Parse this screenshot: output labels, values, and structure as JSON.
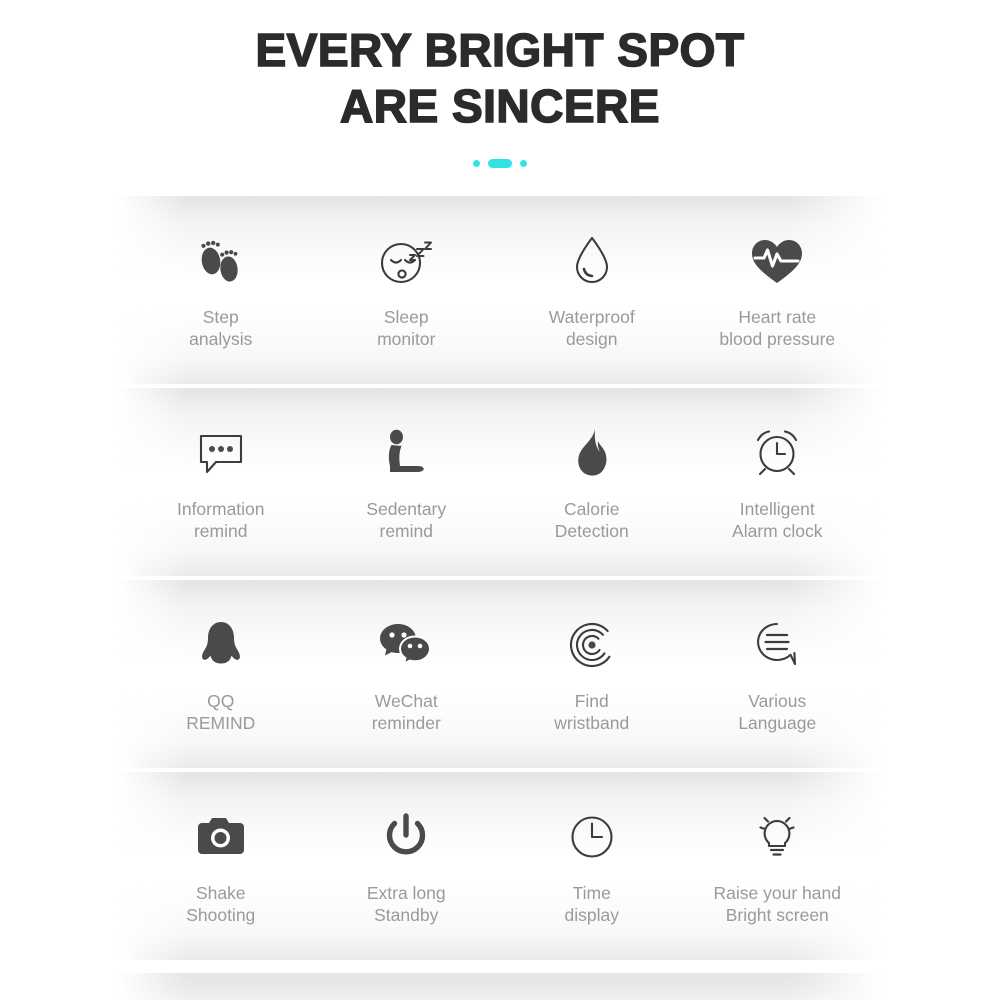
{
  "header": {
    "line1": "EVERY BRIGHT SPOT",
    "line2": "ARE SINCERE",
    "accent_color": "#33e2e2",
    "decoration": [
      "dot",
      "pill",
      "dot"
    ]
  },
  "colors": {
    "heading": "#2b2b2b",
    "label": "#9a9a9c",
    "icon": "#4a4a4a",
    "band": "#e2e3e5",
    "page_background": "#ffffff"
  },
  "rows": [
    {
      "cells": [
        {
          "icon": "footprints-icon",
          "label": "Step\nanalysis"
        },
        {
          "icon": "sleeping-face-icon",
          "label": "Sleep\nmonitor"
        },
        {
          "icon": "water-drop-icon",
          "label": "Waterproof\ndesign"
        },
        {
          "icon": "heart-pulse-icon",
          "label": "Heart rate\nblood pressure"
        }
      ]
    },
    {
      "cells": [
        {
          "icon": "speech-bubble-dots-icon",
          "label": "Information\nremind"
        },
        {
          "icon": "sitting-person-icon",
          "label": "Sedentary\nremind"
        },
        {
          "icon": "flame-icon",
          "label": "Calorie\nDetection"
        },
        {
          "icon": "alarm-clock-icon",
          "label": "Intelligent\nAlarm clock"
        }
      ]
    },
    {
      "cells": [
        {
          "icon": "qq-penguin-icon",
          "label": "QQ\nREMIND"
        },
        {
          "icon": "wechat-bubbles-icon",
          "label": "WeChat\nreminder"
        },
        {
          "icon": "radar-signal-icon",
          "label": "Find\nwristband"
        },
        {
          "icon": "speech-bubble-lines-icon",
          "label": "Various\nLanguage"
        }
      ]
    },
    {
      "cells": [
        {
          "icon": "camera-icon",
          "label": "Shake\nShooting"
        },
        {
          "icon": "power-icon",
          "label": "Extra long\nStandby"
        },
        {
          "icon": "clock-icon",
          "label": "Time\ndisplay"
        },
        {
          "icon": "lightbulb-icon",
          "label": "Raise your hand\nBright screen"
        }
      ]
    }
  ]
}
